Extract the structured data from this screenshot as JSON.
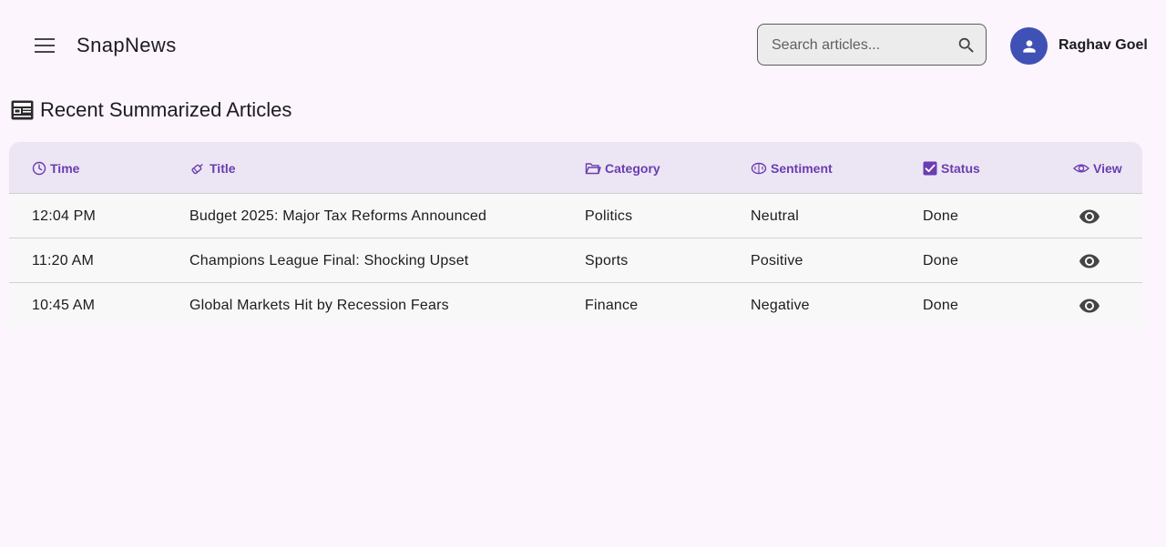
{
  "app": {
    "title": "SnapNews"
  },
  "search": {
    "placeholder": "Search articles...",
    "value": ""
  },
  "user": {
    "name": "Raghav Goel"
  },
  "section": {
    "title": "Recent Summarized Articles",
    "icon": "newspaper-icon"
  },
  "table": {
    "columns": [
      {
        "label": "Time",
        "icon": "clock-icon"
      },
      {
        "label": "Title",
        "icon": "pin-icon"
      },
      {
        "label": "Category",
        "icon": "folder-icon"
      },
      {
        "label": "Sentiment",
        "icon": "brain-icon"
      },
      {
        "label": "Status",
        "icon": "checkbox-icon"
      },
      {
        "label": "View",
        "icon": "eye-icon"
      }
    ],
    "rows": [
      {
        "time": "12:04 PM",
        "title": "Budget 2025: Major Tax Reforms Announced",
        "category": "Politics",
        "sentiment": "Neutral",
        "status": "Done"
      },
      {
        "time": "11:20 AM",
        "title": "Champions League Final: Shocking Upset",
        "category": "Sports",
        "sentiment": "Positive",
        "status": "Done"
      },
      {
        "time": "10:45 AM",
        "title": "Global Markets Hit by Recession Fears",
        "category": "Finance",
        "sentiment": "Negative",
        "status": "Done"
      }
    ]
  },
  "colors": {
    "background": "#fcf5fd",
    "header_accent": "#6a3db0",
    "header_row_bg": "#ece6f4",
    "avatar_bg": "#3f51b5"
  }
}
